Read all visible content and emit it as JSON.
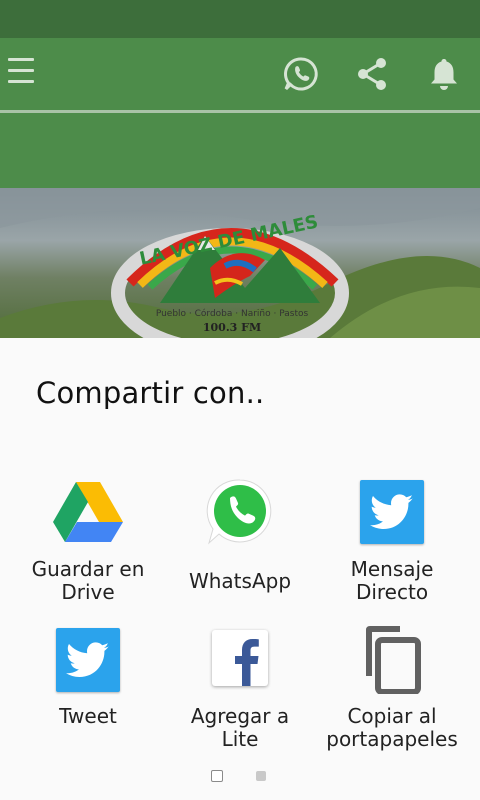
{
  "app_bar": {
    "menu_icon": "hamburger-menu-icon",
    "actions": [
      "whatsapp-icon",
      "share-icon",
      "bell-icon"
    ]
  },
  "banner": {
    "logo_title": "LA VOZ DE MALES",
    "logo_frequency": "100.3 FM",
    "logo_ribbon": "Pueblo · Córdoba · Nariño · Pastos"
  },
  "share_sheet": {
    "title": "Compartir con..",
    "items": [
      {
        "label_line1": "Guardar en",
        "label_line2": "Drive",
        "icon": "google-drive-icon"
      },
      {
        "label_line1": "WhatsApp",
        "label_line2": "",
        "icon": "whatsapp-icon"
      },
      {
        "label_line1": "Mensaje",
        "label_line2": "Directo",
        "icon": "twitter-icon"
      },
      {
        "label_line1": "Tweet",
        "label_line2": "",
        "icon": "twitter-icon"
      },
      {
        "label_line1": "Agregar a",
        "label_line2": "Lite",
        "icon": "facebook-icon"
      },
      {
        "label_line1": "Copiar al",
        "label_line2": "portapapeles",
        "icon": "copy-icon"
      }
    ],
    "page_indicator": {
      "current": 1,
      "total": 2
    }
  },
  "colors": {
    "status_bar": "#3d6e3b",
    "app_bar": "#4d8c4a",
    "sheet_bg": "#fafafa",
    "twitter": "#2ba3ec",
    "whatsapp": "#2fbe48",
    "facebook": "#3b5998"
  }
}
